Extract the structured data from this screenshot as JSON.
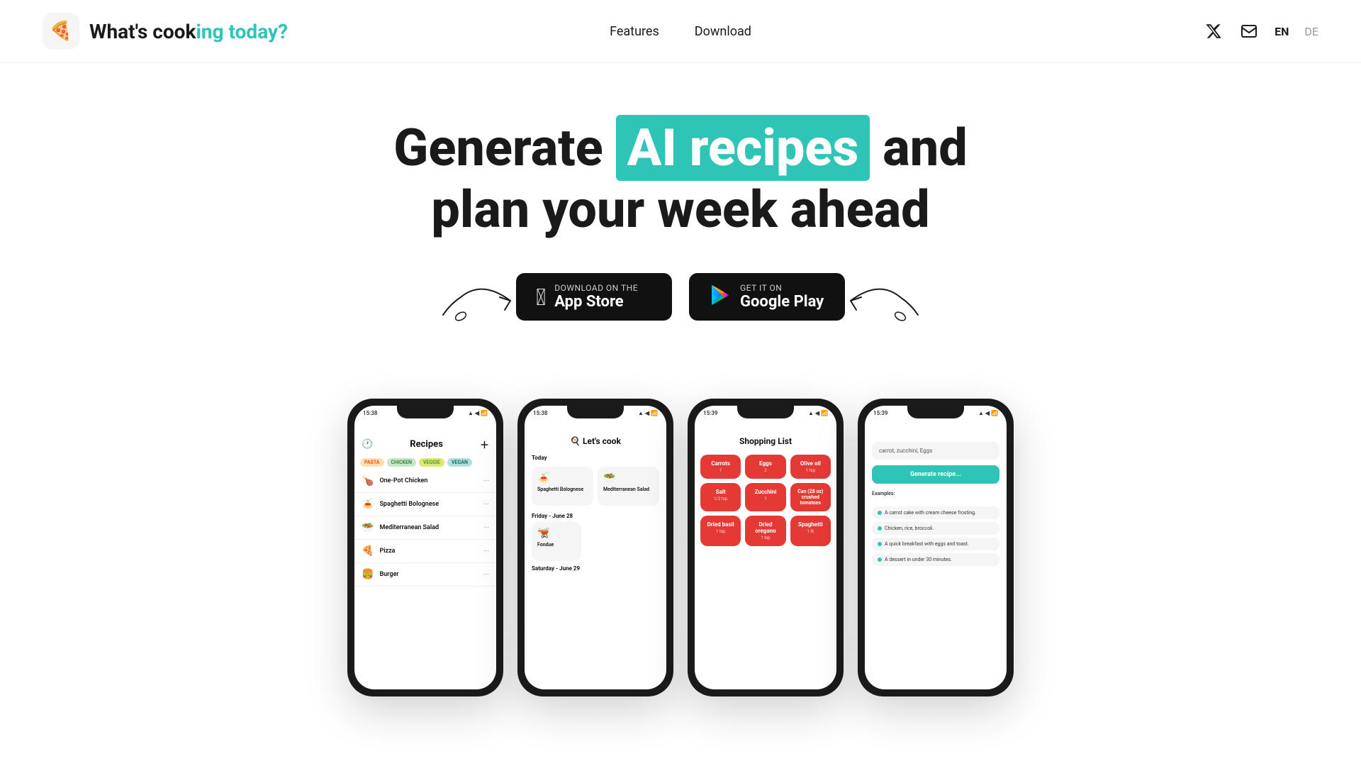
{
  "nav": {
    "logo_emoji": "🍕",
    "title_plain": "What's cook",
    "title_highlight": "ing today?",
    "links": [
      {
        "label": "Features",
        "id": "features"
      },
      {
        "label": "Download",
        "id": "download"
      }
    ],
    "lang_en": "EN",
    "lang_de": "DE"
  },
  "hero": {
    "heading_line1_plain": "Generate ",
    "heading_highlight": "AI recipes",
    "heading_line1_end": " and",
    "heading_line2": "plan your week ahead"
  },
  "cta": {
    "appstore_sub": "Download on the",
    "appstore_main": "App Store",
    "googleplay_sub": "GET IT ON",
    "googleplay_main": "Google Play"
  },
  "phones": [
    {
      "id": "phone-recipes",
      "time": "15:38",
      "screen_title": "Recipes",
      "tags": [
        "PASTA",
        "CHICKEN",
        "VEGGIE",
        "VEGAN"
      ],
      "recipes": [
        {
          "emoji": "🍗",
          "name": "One-Pot Chicken"
        },
        {
          "emoji": "🍝",
          "name": "Spaghetti Bolognese"
        },
        {
          "emoji": "🥗",
          "name": "Mediterranean Salad"
        },
        {
          "emoji": "🍕",
          "name": "Pizza"
        },
        {
          "emoji": "🍔",
          "name": "Burger"
        }
      ]
    },
    {
      "id": "phone-letscook",
      "time": "15:38",
      "screen_title": "🍳 Let's cook",
      "section_today": "Today",
      "section_friday": "Friday - June 28",
      "section_saturday": "Saturday - June 29",
      "cards": [
        {
          "emoji": "🍝",
          "name": "Spaghetti Bolognese"
        },
        {
          "emoji": "🥗",
          "name": "Mediterranean Salad"
        }
      ],
      "fondue_card": {
        "emoji": "🫕",
        "name": "Fondue"
      }
    },
    {
      "id": "phone-shopping",
      "time": "15:39",
      "screen_title": "Shopping List",
      "items": [
        {
          "name": "Carrots",
          "qty": "1"
        },
        {
          "name": "Eggs",
          "qty": "2"
        },
        {
          "name": "Olive oil",
          "qty": "1 tsp"
        },
        {
          "name": "Salt",
          "qty": "1/2 tsp"
        },
        {
          "name": "Zucchini",
          "qty": "1"
        },
        {
          "name": "Can (28 oz) crushed tomatoes",
          "qty": ""
        },
        {
          "name": "Dried basil",
          "qty": "1 tsp"
        },
        {
          "name": "Dried oregano",
          "qty": "1 tsp"
        },
        {
          "name": "Spaghetti",
          "qty": "1 lb"
        }
      ]
    },
    {
      "id": "phone-ai",
      "time": "15:39",
      "input_placeholder": "carrot, zucchini, Eggs",
      "generate_btn": "Generate recipe...",
      "examples_title": "Examples:",
      "examples": [
        "A carrot cake with cream cheese frosting.",
        "Chicken, rice, broccoli.",
        "A quick breakfast with eggs and toast.",
        "A dessert in under 30 minutes."
      ]
    }
  ],
  "colors": {
    "teal": "#2ec4b6",
    "dark": "#1a1a1a",
    "red": "#e53935",
    "white": "#ffffff"
  }
}
